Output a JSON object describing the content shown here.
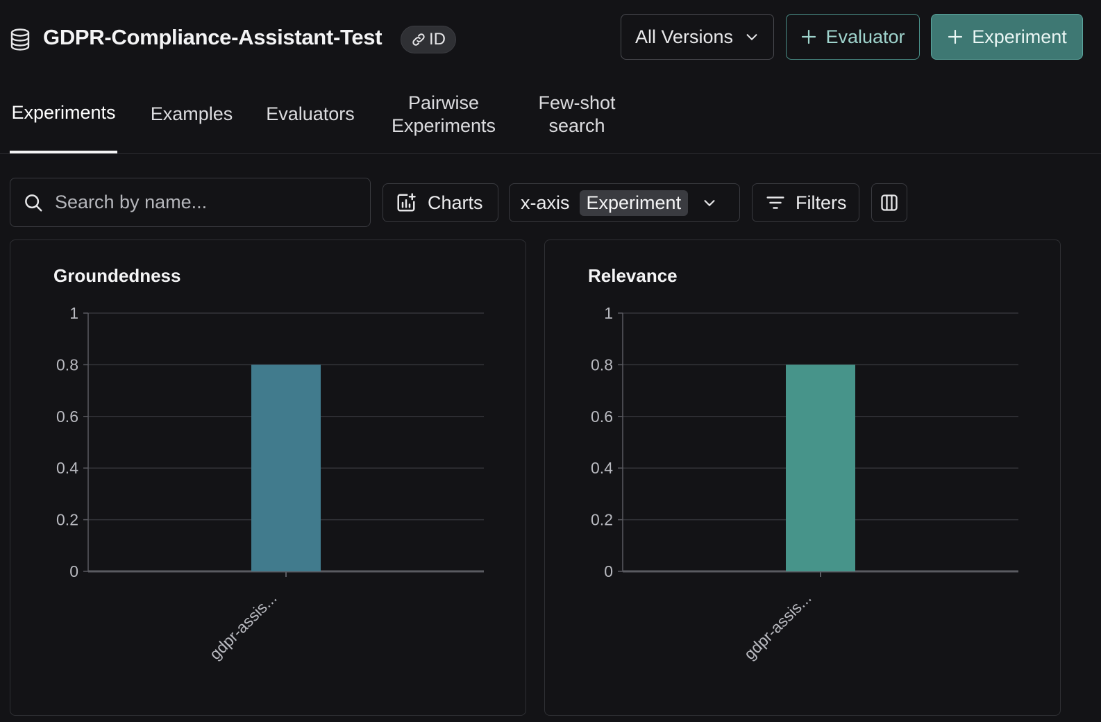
{
  "header": {
    "title": "GDPR-Compliance-Assistant-Test",
    "id_chip_label": "ID",
    "versions_label": "All Versions",
    "evaluator_button_label": "Evaluator",
    "experiment_button_label": "Experiment"
  },
  "tabs": [
    {
      "label": "Experiments",
      "active": true
    },
    {
      "label": "Examples",
      "active": false
    },
    {
      "label": "Evaluators",
      "active": false
    },
    {
      "label": "Pairwise Experiments",
      "active": false
    },
    {
      "label": "Few-shot search",
      "active": false
    }
  ],
  "toolbar": {
    "search_placeholder": "Search by name...",
    "charts_label": "Charts",
    "xaxis_label": "x-axis",
    "xaxis_value": "Experiment",
    "filters_label": "Filters"
  },
  "colors": {
    "accent": "#3e7873",
    "groundedness_bar": "#417b8d",
    "relevance_bar": "#47948a"
  },
  "chart_data": [
    {
      "type": "bar",
      "title": "Groundedness",
      "categories": [
        "gdpr-assis..."
      ],
      "values": [
        0.8
      ],
      "ylim": [
        0,
        1
      ],
      "yticks": [
        "0",
        "0.2",
        "0.4",
        "0.6",
        "0.8",
        "1"
      ],
      "grid": true,
      "color": "#417b8d"
    },
    {
      "type": "bar",
      "title": "Relevance",
      "categories": [
        "gdpr-assis..."
      ],
      "values": [
        0.8
      ],
      "ylim": [
        0,
        1
      ],
      "yticks": [
        "0",
        "0.2",
        "0.4",
        "0.6",
        "0.8",
        "1"
      ],
      "grid": true,
      "color": "#47948a"
    }
  ]
}
